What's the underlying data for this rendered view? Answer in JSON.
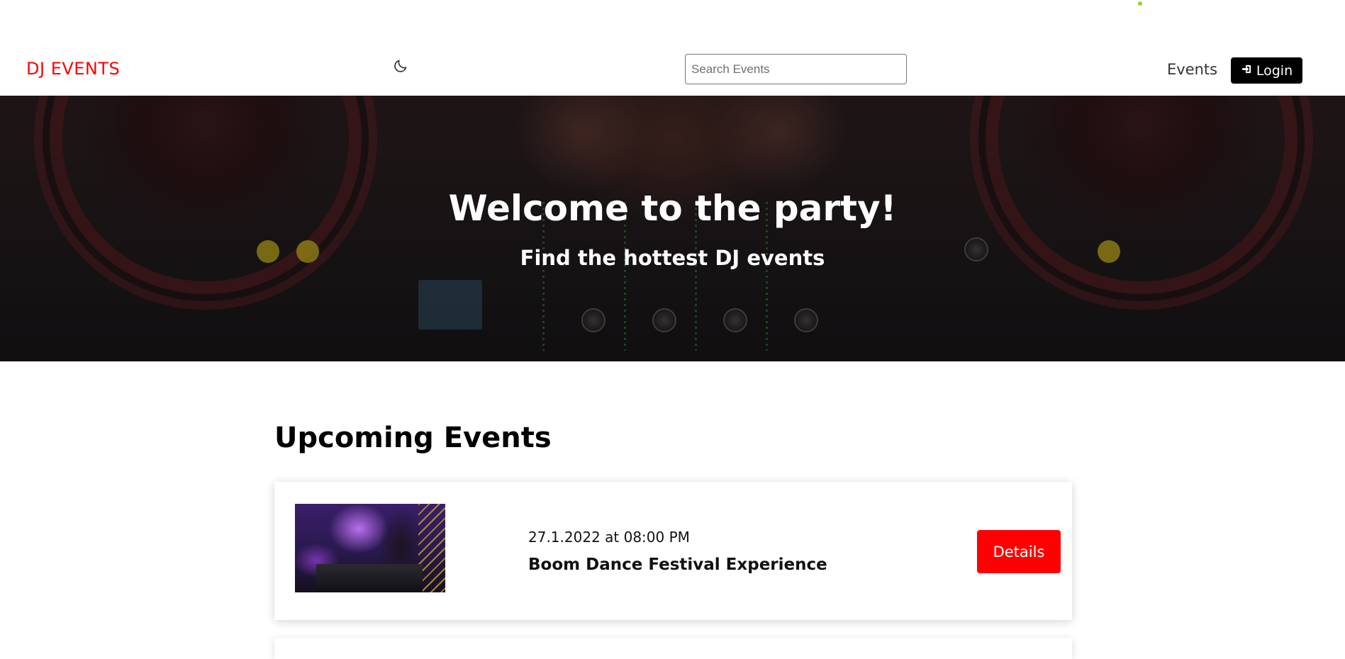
{
  "header": {
    "logo_text": "DJ EVENTS",
    "theme_toggle_icon": "moon-icon",
    "search_placeholder": "Search Events",
    "search_value": "",
    "nav_events_label": "Events",
    "login_icon": "sign-in-icon",
    "login_label": "Login"
  },
  "hero": {
    "title": "Welcome to the party!",
    "subtitle": "Find the hottest DJ events"
  },
  "main": {
    "section_title": "Upcoming Events",
    "events": [
      {
        "date": "27.1.2022 at 08:00 PM",
        "name": "Boom Dance Festival Experience",
        "details_label": "Details"
      }
    ]
  },
  "colors": {
    "brand": "#ff0000",
    "login_bg": "#000000",
    "details_bg": "#ff0000"
  }
}
